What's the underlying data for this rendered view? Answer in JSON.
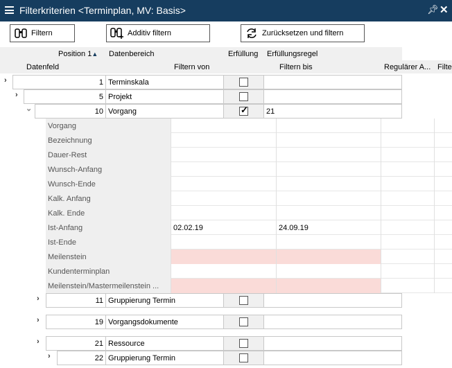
{
  "title": "Filterkriterien <Terminplan, MV: Basis>",
  "toolbar": {
    "filter_label": "Filtern",
    "additive_label": "Additiv filtern",
    "reset_label": "Zurücksetzen und filtern"
  },
  "headers": {
    "position": "Position",
    "sort_index": "1",
    "datenbereich": "Datenbereich",
    "erfuellung": "Erfüllung",
    "erfuellungsregel": "Erfüllungsregel",
    "datenfeld": "Datenfeld",
    "filtern_von": "Filtern von",
    "filtern_bis": "Filtern bis",
    "regulaer": "Regulärer A...",
    "filte": "Filte"
  },
  "rows": [
    {
      "position": "1",
      "name": "Terminskala",
      "checked": false,
      "rule": ""
    },
    {
      "position": "5",
      "name": "Projekt",
      "checked": false,
      "rule": ""
    },
    {
      "position": "10",
      "name": "Vorgang",
      "checked": true,
      "rule": "21"
    },
    {
      "position": "11",
      "name": "Gruppierung Termin",
      "checked": false,
      "rule": ""
    },
    {
      "position": "19",
      "name": "Vorgangsdokumente",
      "checked": false,
      "rule": ""
    },
    {
      "position": "21",
      "name": "Ressource",
      "checked": false,
      "rule": ""
    },
    {
      "position": "22",
      "name": "Gruppierung Termin",
      "checked": false,
      "rule": ""
    }
  ],
  "fields": [
    {
      "label": "Vorgang",
      "von": "",
      "bis": ""
    },
    {
      "label": "Bezeichnung",
      "von": "",
      "bis": ""
    },
    {
      "label": "Dauer-Rest",
      "von": "",
      "bis": ""
    },
    {
      "label": "Wunsch-Anfang",
      "von": "",
      "bis": ""
    },
    {
      "label": "Wunsch-Ende",
      "von": "",
      "bis": ""
    },
    {
      "label": "Kalk. Anfang",
      "von": "",
      "bis": ""
    },
    {
      "label": "Kalk. Ende",
      "von": "",
      "bis": ""
    },
    {
      "label": "Ist-Anfang",
      "von": "02.02.19",
      "bis": "24.09.19"
    },
    {
      "label": "Ist-Ende",
      "von": "",
      "bis": ""
    },
    {
      "label": "Meilenstein",
      "von": "",
      "bis": ""
    },
    {
      "label": "Kundenterminplan",
      "von": "",
      "bis": ""
    },
    {
      "label": "Meilenstein/Mastermeilenstein ...",
      "von": "",
      "bis": ""
    }
  ],
  "colors": {
    "titlebar": "#163d5f",
    "invalid_field": "#fadbd8"
  }
}
